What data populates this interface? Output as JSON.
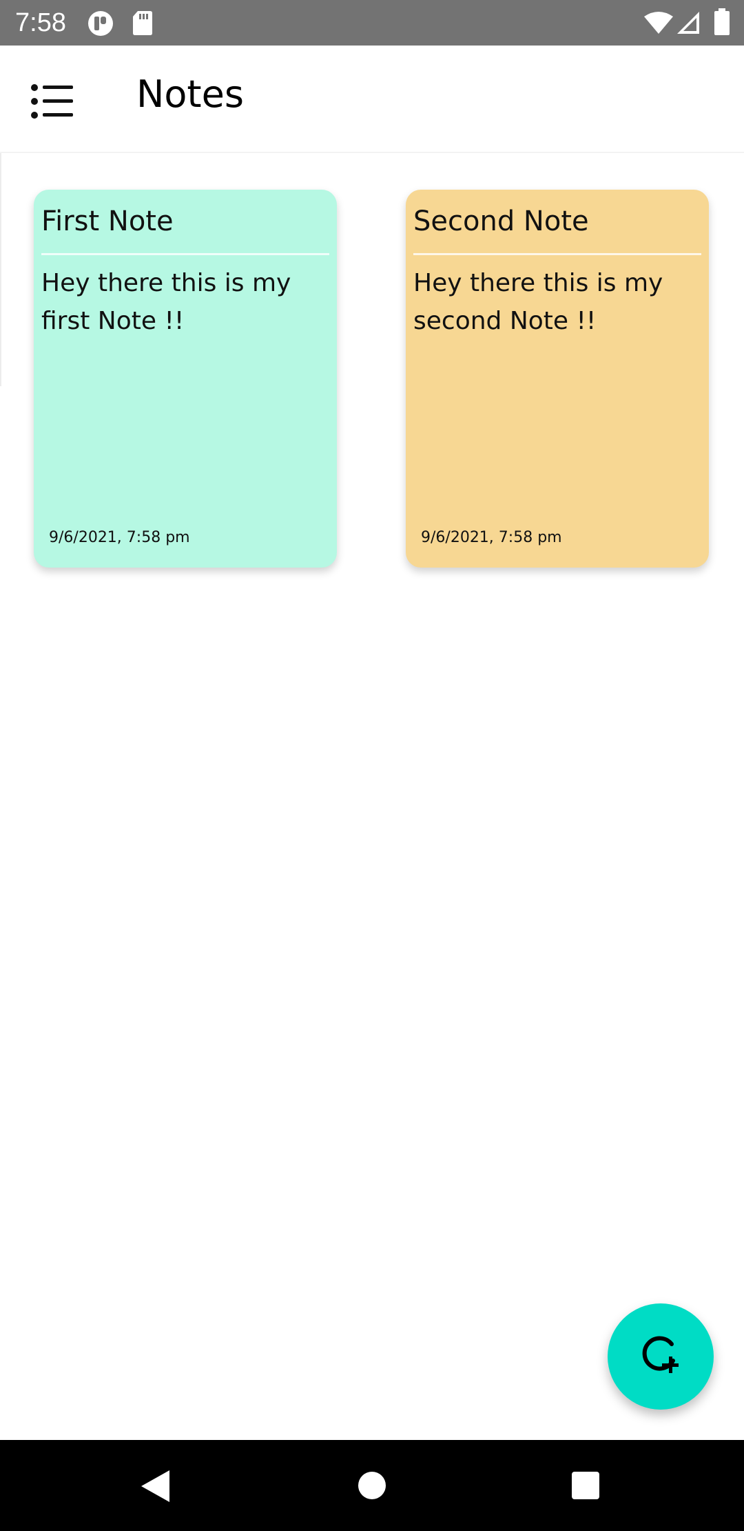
{
  "status_bar": {
    "time": "7:58",
    "icons": [
      "notification-app-icon",
      "sd-card-icon",
      "wifi-icon",
      "signal-icon",
      "battery-icon"
    ]
  },
  "app_bar": {
    "title": "Notes",
    "menu_icon": "list-menu-icon"
  },
  "notes": [
    {
      "title": "First Note",
      "body": "Hey there this is my first Note !!",
      "date": "9/6/2021, 7:58 pm",
      "color": "#b6f8e3"
    },
    {
      "title": "Second Note",
      "body": "Hey there this is my second Note !!",
      "date": "9/6/2021, 7:58 pm",
      "color": "#f7d793"
    }
  ],
  "fab": {
    "icon": "add-note-icon",
    "color": "#00dcc5"
  },
  "nav_bar": {
    "icons": [
      "back-icon",
      "home-icon",
      "recents-icon"
    ]
  }
}
